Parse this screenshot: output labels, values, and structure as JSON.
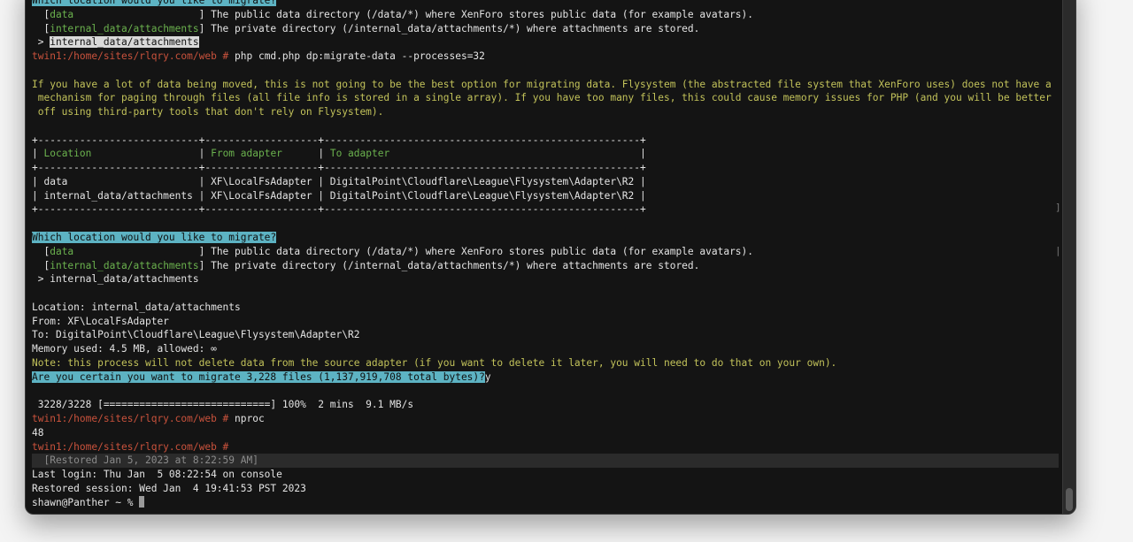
{
  "terminal": {
    "lines": [
      [
        {
          "t": "Which location would you like to migrate?",
          "c": "hl"
        }
      ],
      [
        {
          "t": "  ["
        },
        {
          "t": "data",
          "c": "g"
        },
        {
          "t": "                     ] The public data directory (/data/*) where XenForo stores public data (for example avatars)."
        }
      ],
      [
        {
          "t": "  ["
        },
        {
          "t": "internal_data/attachments",
          "c": "g"
        },
        {
          "t": "] The private directory (/internal_data/attachments/*) where attachments are stored."
        }
      ],
      [
        {
          "t": " > "
        },
        {
          "t": "internal_data/attachments",
          "c": "hw"
        }
      ],
      [
        {
          "t": "twin1:/home/sites/rlqry.com/web # ",
          "c": "r"
        },
        {
          "t": "php cmd.php dp:migrate-data --processes=32"
        }
      ],
      [
        {
          "t": ""
        }
      ],
      [
        {
          "t": "If you have a lot of data being moved, this is not going to be the best option for migrating data. Flysystem (the abstracted file system that XenForo uses) does not have a",
          "c": "y"
        }
      ],
      [
        {
          "t": " mechanism for paging through files (all file info is stored in a single array). If you have too many files, this could cause memory issues for PHP (and you will be better",
          "c": "y"
        }
      ],
      [
        {
          "t": " off using third-party tools that don't rely on Flysystem).",
          "c": "y"
        }
      ],
      [
        {
          "t": ""
        }
      ],
      [
        {
          "t": "+---------------------------+-------------------+-----------------------------------------------------+"
        }
      ],
      [
        {
          "t": "| "
        },
        {
          "t": "Location                  ",
          "c": "g"
        },
        {
          "t": "| "
        },
        {
          "t": "From adapter      ",
          "c": "g"
        },
        {
          "t": "| "
        },
        {
          "t": "To adapter                                          ",
          "c": "g"
        },
        {
          "t": "|"
        }
      ],
      [
        {
          "t": "+---------------------------+-------------------+-----------------------------------------------------+"
        }
      ],
      [
        {
          "t": "| data                      | XF\\LocalFsAdapter | DigitalPoint\\Cloudflare\\League\\Flysystem\\Adapter\\R2 |"
        }
      ],
      [
        {
          "t": "| internal_data/attachments | XF\\LocalFsAdapter | DigitalPoint\\Cloudflare\\League\\Flysystem\\Adapter\\R2 |"
        }
      ],
      [
        {
          "t": "+---------------------------+-------------------+-----------------------------------------------------+"
        }
      ],
      [
        {
          "t": ""
        }
      ],
      [
        {
          "t": "Which location would you like to migrate?",
          "c": "hl"
        }
      ],
      [
        {
          "t": "  ["
        },
        {
          "t": "data",
          "c": "g"
        },
        {
          "t": "                     ] The public data directory (/data/*) where XenForo stores public data (for example avatars)."
        }
      ],
      [
        {
          "t": "  ["
        },
        {
          "t": "internal_data/attachments",
          "c": "g"
        },
        {
          "t": "] The private directory (/internal_data/attachments/*) where attachments are stored."
        }
      ],
      [
        {
          "t": " > internal_data/attachments"
        }
      ],
      [
        {
          "t": ""
        }
      ],
      [
        {
          "t": "Location: internal_data/attachments"
        }
      ],
      [
        {
          "t": "From: XF\\LocalFsAdapter"
        }
      ],
      [
        {
          "t": "To: DigitalPoint\\Cloudflare\\League\\Flysystem\\Adapter\\R2"
        }
      ],
      [
        {
          "t": "Memory used: 4.5 MB, allowed: ∞"
        }
      ],
      [
        {
          "t": "Note: this process will not delete data from the source adapter (if you want to delete it later, you will need to do that on your own).",
          "c": "y"
        }
      ],
      [
        {
          "t": "Are you certain you want to migrate 3,228 files (1,137,919,708 total bytes)?",
          "c": "hl"
        },
        {
          "t": "y"
        }
      ],
      [
        {
          "t": ""
        }
      ],
      [
        {
          "t": " 3228/3228 [============================] 100%  2 mins  9.1 MB/s"
        }
      ],
      [
        {
          "t": "twin1:/home/sites/rlqry.com/web # ",
          "c": "r"
        },
        {
          "t": "nproc"
        }
      ],
      [
        {
          "t": "48"
        }
      ],
      [
        {
          "t": "twin1:/home/sites/rlqry.com/web #",
          "c": "r"
        }
      ],
      [
        {
          "t": "  [Restored Jan 5, 2023 at 8:22:59 AM]",
          "c": "restored"
        }
      ],
      [
        {
          "t": "Last login: Thu Jan  5 08:22:54 on console"
        }
      ],
      [
        {
          "t": "Restored session: Wed Jan  4 19:41:53 PST 2023"
        }
      ],
      [
        {
          "t": "shawn@Panther ~ % "
        },
        {
          "t": "",
          "c": "cursor"
        }
      ]
    ]
  },
  "colors": {
    "prompt": "#c9523c",
    "warning": "#c2c25a",
    "option": "#6bb24e",
    "highlight": "#5db3c3",
    "background": "#141414"
  }
}
